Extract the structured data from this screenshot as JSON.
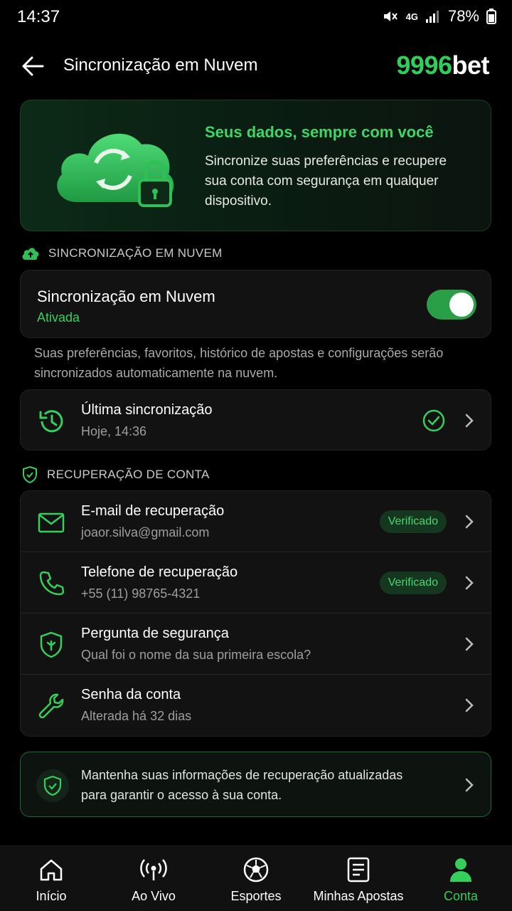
{
  "status_bar": {
    "time": "14:37",
    "network": "4G",
    "battery": "78%"
  },
  "header": {
    "title": "Sincronização em Nuvem",
    "brand_num": "9996",
    "brand_txt": "bet"
  },
  "hero": {
    "title": "Seus dados, sempre com você",
    "description": "Sincronize suas preferências e recupere sua conta com segurança em qualquer dispositivo."
  },
  "sync_section": {
    "label": "SINCRONIZAÇÃO EM NUVEM",
    "toggle_title": "Sincronização em Nuvem",
    "toggle_status": "Ativada",
    "toggle_on": true,
    "note": "Suas preferências, favoritos, histórico de apostas e configurações serão sincronizados automaticamente na nuvem.",
    "last_sync": {
      "title": "Última sincronização",
      "value": "Hoje, 14:36"
    }
  },
  "recovery_section": {
    "label": "RECUPERAÇÃO DE CONTA",
    "items": [
      {
        "title": "E-mail de recuperação",
        "sub": "joaor.silva@gmail.com",
        "badge": "Verificado",
        "icon": "mail-icon"
      },
      {
        "title": "Telefone de recuperação",
        "sub": "+55 (11) 98765-4321",
        "badge": "Verificado",
        "icon": "phone-icon"
      },
      {
        "title": "Pergunta de segurança",
        "sub": "Qual foi o nome da sua primeira escola?",
        "icon": "shield-icon"
      },
      {
        "title": "Senha da conta",
        "sub": "Alterada há 32 dias",
        "icon": "wrench-icon"
      }
    ]
  },
  "tip": {
    "text": "Mantenha suas informações de recuperação atualizadas para garantir o acesso à sua conta."
  },
  "nav": {
    "items": [
      {
        "label": "Início",
        "icon": "home-icon"
      },
      {
        "label": "Ao Vivo",
        "icon": "live-icon"
      },
      {
        "label": "Esportes",
        "icon": "soccer-ball-icon"
      },
      {
        "label": "Minhas Apostas",
        "icon": "bets-icon"
      },
      {
        "label": "Conta",
        "icon": "user-icon"
      }
    ],
    "active": "Conta"
  },
  "colors": {
    "accent": "#36cf5c",
    "background": "#000000",
    "card": "#121212"
  }
}
